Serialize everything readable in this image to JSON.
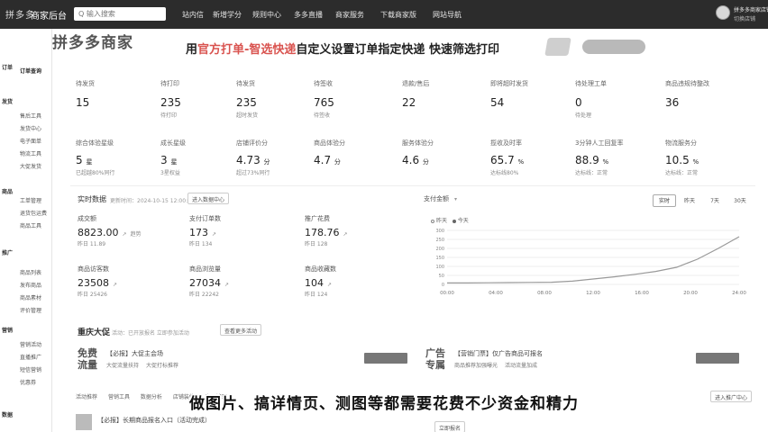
{
  "topbar": {
    "logo": "拼多多",
    "brand": "商家后台",
    "search_value": "Q 输入搜索",
    "nav": [
      "站内信",
      "新增学分",
      "规则中心",
      "多多直播",
      "商家服务",
      "下载商家版",
      "网站导航"
    ],
    "user_name": "拼多多商家店铺",
    "user_sub": "切换店铺"
  },
  "sidebar": {
    "groups": [
      {
        "label": "订单",
        "top": 40
      },
      {
        "label": "发货",
        "top": 80
      },
      {
        "label": "商品",
        "top": 152
      },
      {
        "label": "推广",
        "top": 230
      },
      {
        "label": "营销",
        "top": 330
      },
      {
        "label": "数据",
        "top": 420
      }
    ],
    "items": [
      "订单查询",
      "售后工具",
      "发货中心",
      "电子面单",
      "物流工具",
      "大促发货",
      "工单管理",
      "退货包运费",
      "商品工具",
      "商品列表",
      "发布商品",
      "商品素材",
      "评价管理",
      "营销活动",
      "直播推广",
      "短信营销",
      "优惠券"
    ]
  },
  "main": {
    "big_title": "拼多多商家",
    "banner": {
      "prefix": "用",
      "highlight": "官方打单-智选快递",
      "suffix": "自定义设置订单指定快递 快速筛选打印"
    },
    "metrics_row1": [
      {
        "label": "待发货",
        "value": "15",
        "sub": ""
      },
      {
        "label": "待打印",
        "value": "235",
        "sub": "待打印"
      },
      {
        "label": "待发货",
        "value": "235",
        "sub": "超时发货"
      },
      {
        "label": "待签收",
        "value": "765",
        "sub": "待签收"
      },
      {
        "label": "退款/售后",
        "value": "22",
        "sub": ""
      },
      {
        "label": "即将超时发货",
        "value": "54",
        "sub": ""
      },
      {
        "label": "待处理工单",
        "value": "0",
        "sub": "待处理"
      },
      {
        "label": "商品违规待整改",
        "value": "36",
        "sub": ""
      }
    ],
    "metrics_row2": [
      {
        "label": "综合体验星级",
        "value": "5",
        "unit": "星",
        "sub": "已超越80%同行"
      },
      {
        "label": "成长星级",
        "value": "3",
        "unit": "星",
        "sub": "3星权益"
      },
      {
        "label": "店铺评价分",
        "value": "4.73",
        "unit": "分",
        "sub": "超过73%同行"
      },
      {
        "label": "商品体验分",
        "value": "4.7",
        "unit": "分",
        "sub": ""
      },
      {
        "label": "服务体验分",
        "value": "4.6",
        "unit": "分",
        "sub": ""
      },
      {
        "label": "揽收及时率",
        "value": "65.7",
        "unit": "%",
        "sub": "达标线80%"
      },
      {
        "label": "3分钟人工回复率",
        "value": "88.9",
        "unit": "%",
        "sub": "达标线：正常"
      },
      {
        "label": "物流服务分",
        "value": "10.5",
        "unit": "%",
        "sub": "达标线：正常"
      }
    ],
    "realtime": {
      "title": "实时数据",
      "update": "更新时间：2024-10-15 12:00:00",
      "enter_btn": "进入数据中心",
      "items": [
        {
          "label": "成交额",
          "value": "8823.00",
          "tag": "趋势",
          "sub": "昨日 11.89"
        },
        {
          "label": "支付订单数",
          "value": "173",
          "tag": "",
          "sub": "昨日 134"
        },
        {
          "label": "推广花费",
          "value": "178.76",
          "tag": "",
          "sub": "昨日 128"
        },
        {
          "label": "商品访客数",
          "value": "23508",
          "tag": "",
          "sub": "昨日 25426"
        },
        {
          "label": "商品浏览量",
          "value": "27034",
          "tag": "",
          "sub": "昨日 22242"
        },
        {
          "label": "商品收藏数",
          "value": "104",
          "tag": "",
          "sub": "昨日 124"
        }
      ]
    },
    "chart_panel": {
      "title": "支付金额",
      "tabs": [
        "实时",
        "昨天",
        "7天",
        "30天"
      ],
      "legend": [
        "昨天",
        "今天"
      ]
    },
    "promo": {
      "title": "重庆大促",
      "note": "活动：已开放报名 立即参加活动",
      "note_btn": "查看更多活动",
      "cards": [
        {
          "big": "免费流量",
          "title": "【必报】大促主会场",
          "tags": [
            "大促流量扶持",
            "大促打标推荐"
          ]
        },
        {
          "big": "广告专属",
          "title": "【营销门票】仅广告商品可报名",
          "tags": [
            "商品推荐加强曝光",
            "活动流量加成"
          ]
        }
      ]
    },
    "bottom": {
      "tabs": [
        "活动推荐",
        "营销工具",
        "数据分析",
        "店铺装修",
        "商品管理"
      ],
      "right_btn": "进入推广中心",
      "item_title": "【必报】长期商品报名入口（活动完成）",
      "item_btn": "立即报名"
    }
  },
  "subtitle": "做图片、搞详情页、测图等都需要花费不少资金和精力",
  "chart_data": {
    "type": "line",
    "x": [
      "00:00",
      "04:00",
      "08:00",
      "12:00",
      "16:00",
      "20:00",
      "24:00"
    ],
    "y_ticks": [
      0,
      50,
      100,
      150,
      200,
      250,
      300
    ],
    "ylim": [
      0,
      300
    ],
    "series": [
      {
        "name": "今天",
        "values": [
          8,
          8,
          9,
          10,
          11,
          12,
          18,
          30,
          42,
          56,
          72,
          95,
          140,
          200,
          265
        ]
      }
    ],
    "grid": true,
    "legend_placement": "top-left"
  }
}
